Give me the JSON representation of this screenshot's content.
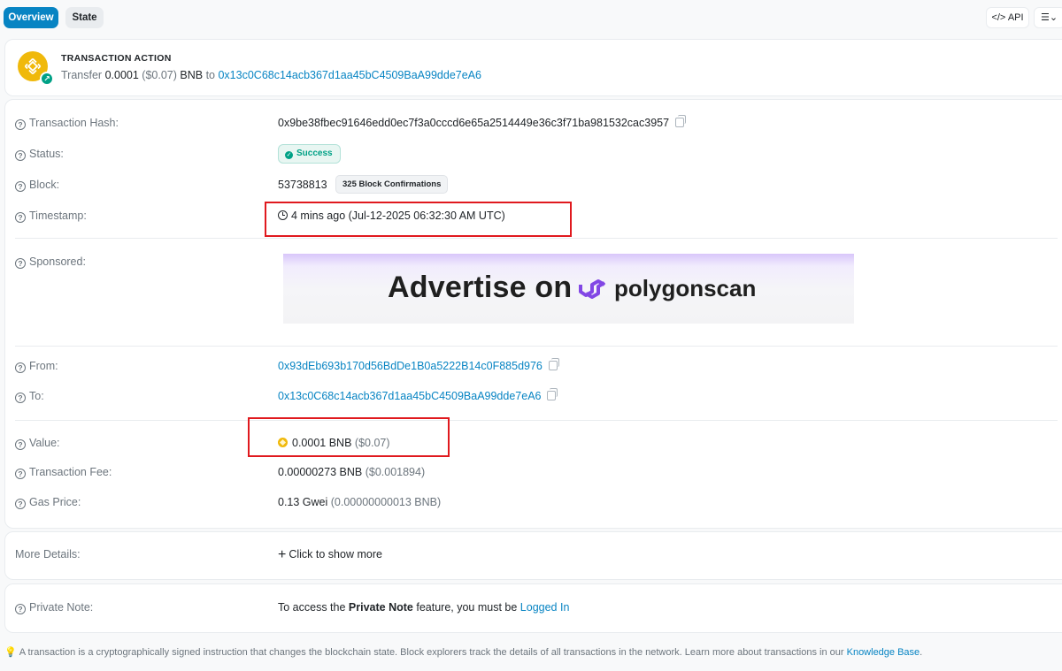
{
  "tabs": {
    "overview": "Overview",
    "state": "State"
  },
  "toolbar": {
    "api_label": "API",
    "menu_icon": "list-icon"
  },
  "action": {
    "title": "TRANSACTION ACTION",
    "verb": "Transfer",
    "amount": "0.0001",
    "usd": "($0.07)",
    "token": "BNB",
    "to_word": "to",
    "to_address": "0x13c0C68c14acb367d1aa45bC4509BaA99dde7eA6"
  },
  "details": {
    "hash": {
      "label": "Transaction Hash:",
      "value": "0x9be38fbec91646edd0ec7f3a0cccd6e65a2514449e36c3f71ba981532cac3957"
    },
    "status": {
      "label": "Status:",
      "value": "Success"
    },
    "block": {
      "label": "Block:",
      "number": "53738813",
      "confirmations": "325 Block Confirmations"
    },
    "timestamp": {
      "label": "Timestamp:",
      "value": "4 mins ago (Jul-12-2025 06:32:30 AM UTC)"
    },
    "sponsored": {
      "label": "Sponsored:",
      "ad_text": "Advertise on",
      "ad_brand": "polygonscan"
    },
    "from": {
      "label": "From:",
      "value": "0x93dEb693b170d56BdDe1B0a5222B14c0F885d976"
    },
    "to": {
      "label": "To:",
      "value": "0x13c0C68c14acb367d1aa45bC4509BaA99dde7eA6"
    },
    "value": {
      "label": "Value:",
      "amount": "0.0001 BNB",
      "usd": "($0.07)"
    },
    "fee": {
      "label": "Transaction Fee:",
      "amount": "0.00000273 BNB",
      "usd": "($0.001894)"
    },
    "gas": {
      "label": "Gas Price:",
      "amount": "0.13 Gwei",
      "extra": "(0.00000000013 BNB)"
    }
  },
  "more": {
    "label": "More Details:",
    "link": "Click to show more"
  },
  "note": {
    "label": "Private Note:",
    "prefix": "To access the",
    "bold": "Private Note",
    "middle": "feature, you must be",
    "link": "Logged In"
  },
  "footer": {
    "text": "A transaction is a cryptographically signed instruction that changes the blockchain state. Block explorers track the details of all transactions in the network. Learn more about transactions in our",
    "link": "Knowledge Base",
    "end": "."
  },
  "colors": {
    "accent": "#0784c3",
    "success": "#00a186",
    "bnb": "#f0b90b",
    "highlight": "#e0191e"
  }
}
